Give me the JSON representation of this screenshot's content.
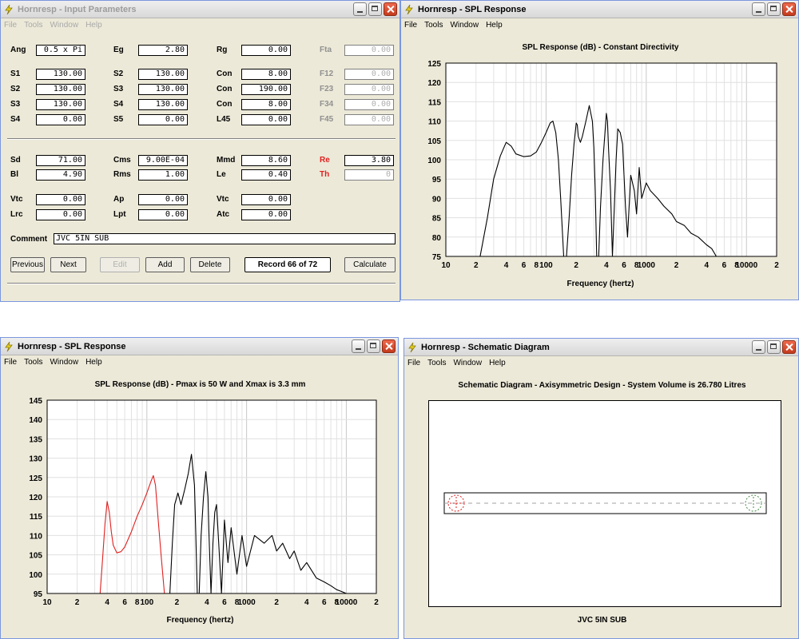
{
  "win_input": {
    "title": "Hornresp - Input Parameters",
    "menu": [
      "File",
      "Tools",
      "Window",
      "Help"
    ],
    "rows": [
      [
        [
          "Ang",
          "0.5 x Pi"
        ],
        [
          "Eg",
          "2.80"
        ],
        [
          "Rg",
          "0.00"
        ],
        [
          "Fta",
          "0.00"
        ]
      ],
      [
        [
          "S1",
          "130.00"
        ],
        [
          "S2",
          "130.00"
        ],
        [
          "Con",
          "8.00"
        ],
        [
          "F12",
          "0.00"
        ]
      ],
      [
        [
          "S2",
          "130.00"
        ],
        [
          "S3",
          "130.00"
        ],
        [
          "Con",
          "190.00"
        ],
        [
          "F23",
          "0.00"
        ]
      ],
      [
        [
          "S3",
          "130.00"
        ],
        [
          "S4",
          "130.00"
        ],
        [
          "Con",
          "8.00"
        ],
        [
          "F34",
          "0.00"
        ]
      ],
      [
        [
          "S4",
          "0.00"
        ],
        [
          "S5",
          "0.00"
        ],
        [
          "L45",
          "0.00"
        ],
        [
          "F45",
          "0.00"
        ]
      ],
      [
        [
          "Sd",
          "71.00"
        ],
        [
          "Cms",
          "9.00E-04"
        ],
        [
          "Mmd",
          "8.60"
        ],
        [
          "Re",
          "3.80"
        ]
      ],
      [
        [
          "Bl",
          "4.90"
        ],
        [
          "Rms",
          "1.00"
        ],
        [
          "Le",
          "0.40"
        ],
        [
          "Th",
          "0"
        ]
      ],
      [
        [
          "Vtc",
          "0.00"
        ],
        [
          "Ap",
          "0.00"
        ],
        [
          "Vtc",
          "0.00"
        ]
      ],
      [
        [
          "Lrc",
          "0.00"
        ],
        [
          "Lpt",
          "0.00"
        ],
        [
          "Atc",
          "0.00"
        ]
      ]
    ],
    "comment_label": "Comment",
    "comment_value": "JVC 5IN SUB",
    "buttons": {
      "previous": "Previous",
      "next": "Next",
      "edit": "Edit",
      "add": "Add",
      "delete": "Delete",
      "record": "Record 66 of 72",
      "calculate": "Calculate"
    }
  },
  "win_spl1": {
    "title": "Hornresp - SPL Response",
    "menu": [
      "File",
      "Tools",
      "Window",
      "Help"
    ],
    "chart_data": {
      "type": "line",
      "title": "SPL Response (dB) - Constant Directivity",
      "xlabel": "Frequency (hertz)",
      "ylabel": "",
      "x_scale": "log",
      "xlim": [
        10,
        20000
      ],
      "ylim": [
        75,
        125
      ],
      "yticks": [
        75,
        80,
        85,
        90,
        95,
        100,
        105,
        110,
        115,
        120,
        125
      ],
      "xtick_labels": [
        "10",
        "2",
        "4",
        "6",
        "8",
        "100",
        "2",
        "4",
        "6",
        "8",
        "1000",
        "2",
        "4",
        "6",
        "8",
        "10000",
        "2"
      ],
      "grid": true,
      "series": [
        {
          "color": "#000000",
          "x": [
            22,
            26,
            30,
            35,
            40,
            45,
            50,
            60,
            70,
            80,
            90,
            100,
            110,
            117,
            125,
            133,
            140,
            150,
            160,
            170,
            180,
            190,
            200,
            205,
            210,
            220,
            230,
            250,
            270,
            290,
            300,
            310,
            320,
            335,
            350,
            370,
            390,
            400,
            410,
            420,
            440,
            460,
            480,
            500,
            520,
            550,
            580,
            600,
            620,
            650,
            700,
            760,
            800,
            850,
            900,
            1000,
            1100,
            1300,
            1500,
            1800,
            2000,
            2400,
            2800,
            3300,
            4000,
            4500,
            5000
          ],
          "y": [
            75,
            85,
            95,
            101,
            104.5,
            103.5,
            101.5,
            100.8,
            101,
            102,
            104.5,
            107,
            109.5,
            110,
            107,
            100,
            90,
            75,
            75,
            85,
            96,
            104,
            109.5,
            109,
            106,
            104.5,
            106,
            110,
            114,
            110,
            103,
            92,
            75,
            75,
            88,
            100,
            108,
            112,
            110,
            103,
            92,
            75,
            88,
            100,
            108,
            107,
            104,
            96,
            88,
            80,
            96,
            92,
            86,
            98,
            90,
            94,
            92,
            90,
            88,
            86,
            84,
            83,
            81,
            80,
            78,
            77,
            75
          ]
        }
      ]
    }
  },
  "win_spl2": {
    "title": "Hornresp - SPL Response",
    "menu": [
      "File",
      "Tools",
      "Window",
      "Help"
    ],
    "chart_data": {
      "type": "line",
      "title": "SPL Response (dB) - Pmax is 50 W and Xmax is 3.3 mm",
      "xlabel": "Frequency (hertz)",
      "ylabel": "",
      "x_scale": "log",
      "xlim": [
        10,
        20000
      ],
      "ylim": [
        95,
        145
      ],
      "yticks": [
        95,
        100,
        105,
        110,
        115,
        120,
        125,
        130,
        135,
        140,
        145
      ],
      "xtick_labels": [
        "10",
        "2",
        "4",
        "6",
        "8",
        "100",
        "2",
        "4",
        "6",
        "8",
        "1000",
        "2",
        "4",
        "6",
        "8",
        "10000",
        "2"
      ],
      "grid": true,
      "series": [
        {
          "color": "#E02020",
          "x": [
            34,
            36,
            38,
            40,
            42,
            44,
            46,
            50,
            55,
            60,
            70,
            80,
            90,
            100,
            110,
            116,
            122,
            130,
            140,
            150
          ],
          "y": [
            95,
            104,
            113,
            118.8,
            116,
            111,
            107.5,
            105.5,
            105.8,
            107,
            111,
            115,
            118,
            121,
            124,
            125.5,
            123,
            114,
            104,
            95
          ],
          "limit": "Xmax"
        },
        {
          "color": "#000000",
          "x": [
            170,
            180,
            190,
            205,
            220,
            240,
            260,
            280,
            300,
            310,
            320,
            335,
            350,
            370,
            390,
            410,
            420,
            440,
            460,
            480,
            500,
            520,
            560,
            600,
            650,
            700,
            800,
            900,
            1000,
            1200,
            1500,
            1800,
            2000,
            2300,
            2700,
            3000,
            3500,
            4000,
            5000,
            6000,
            7000,
            8000,
            9000,
            10000
          ],
          "y": [
            95,
            108,
            118,
            121,
            118,
            122,
            126,
            131,
            123,
            110,
            95,
            95,
            110,
            120,
            126.5,
            120,
            110,
            95,
            108,
            116,
            118,
            110,
            95,
            114,
            103,
            112,
            100,
            110,
            102,
            110,
            108,
            110,
            106,
            108,
            104,
            106,
            101,
            103,
            99,
            98,
            97,
            96,
            95.5,
            95
          ]
        }
      ]
    }
  },
  "win_schem": {
    "title": "Hornresp - Schematic Diagram",
    "menu": [
      "File",
      "Tools",
      "Window",
      "Help"
    ],
    "diagram_title": "Schematic Diagram - Axisymmetric Design - System Volume is 26.780 Litres",
    "caption": "JVC 5IN SUB"
  }
}
